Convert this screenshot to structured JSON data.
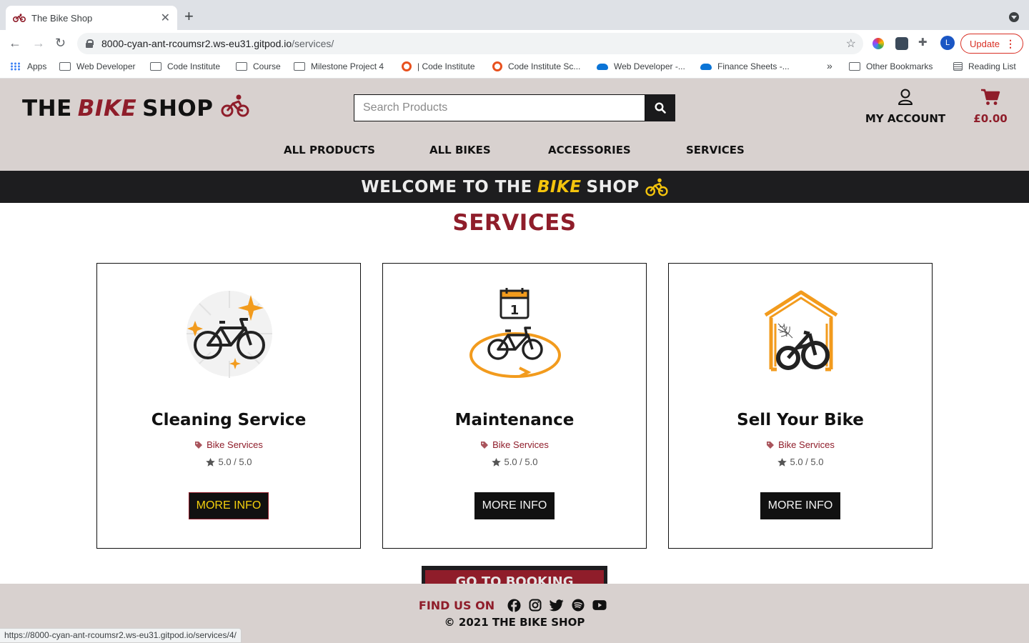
{
  "browser": {
    "tab_title": "The Bike Shop",
    "url_host": "8000-cyan-ant-rcoumsr2.ws-eu31.gitpod.io",
    "url_path": "/services/",
    "profile_initial": "L",
    "update_label": "Update",
    "bookmarks": [
      {
        "label": "Apps",
        "icon": "apps-grid-icon"
      },
      {
        "label": "Web Developer",
        "icon": "folder-icon"
      },
      {
        "label": "Code Institute",
        "icon": "folder-icon"
      },
      {
        "label": "Course",
        "icon": "folder-icon"
      },
      {
        "label": "Milestone Project 4",
        "icon": "folder-icon"
      },
      {
        "label": "| Code Institute",
        "icon": "code-institute-icon"
      },
      {
        "label": "Code Institute Sc...",
        "icon": "code-institute-icon"
      },
      {
        "label": "Web Developer -...",
        "icon": "onedrive-icon"
      },
      {
        "label": "Finance Sheets -...",
        "icon": "onedrive-icon"
      }
    ],
    "overflow": "»",
    "other_bookmarks": "Other Bookmarks",
    "reading_list": "Reading List",
    "status_url": "https://8000-cyan-ant-rcoumsr2.ws-eu31.gitpod.io/services/4/"
  },
  "header": {
    "logo": {
      "the": "THE",
      "bike": "BIKE",
      "shop": "SHOP"
    },
    "search_placeholder": "Search Products",
    "account_label": "MY ACCOUNT",
    "cart_total": "£0.00",
    "nav": [
      "ALL PRODUCTS",
      "ALL BIKES",
      "ACCESSORIES",
      "SERVICES"
    ]
  },
  "banner": {
    "welcome": "WELCOME TO THE",
    "bike": "BIKE",
    "shop": "SHOP"
  },
  "main": {
    "title": "SERVICES",
    "services": [
      {
        "name": "Cleaning Service",
        "category": "Bike Services",
        "rating": "5.0 / 5.0",
        "button": "MORE INFO",
        "image": "cleaning-bike-icon"
      },
      {
        "name": "Maintenance",
        "category": "Bike Services",
        "rating": "5.0 / 5.0",
        "button": "MORE INFO",
        "image": "maintenance-bike-icon"
      },
      {
        "name": "Sell Your Bike",
        "category": "Bike Services",
        "rating": "5.0 / 5.0",
        "button": "MORE INFO",
        "image": "sell-bike-icon"
      }
    ],
    "booking_button": "GO TO BOOKING"
  },
  "footer": {
    "find_us": "FIND US ON",
    "socials": [
      "facebook",
      "instagram",
      "twitter",
      "spotify",
      "youtube"
    ],
    "copyright": "© 2021 THE BIKE SHOP"
  },
  "colors": {
    "brand_red": "#8f1d2a",
    "brand_yellow": "#f4c40d",
    "header_bg": "#d8d1cf",
    "dark": "#1d1d1f",
    "accent_orange": "#f29b1d"
  }
}
